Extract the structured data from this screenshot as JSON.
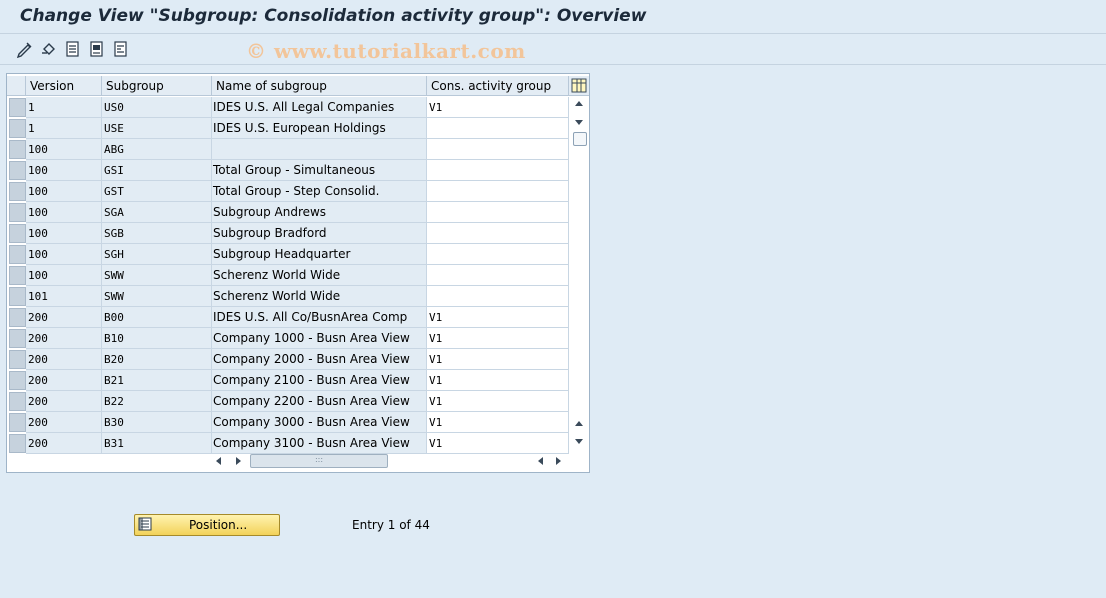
{
  "title": "Change View \"Subgroup: Consolidation activity group\": Overview",
  "watermark": "© www.tutorialkart.com",
  "toolbar": {
    "icons": [
      "change-display-icon",
      "undo-icon",
      "select-all-icon",
      "select-block-icon",
      "deselect-all-icon"
    ]
  },
  "table": {
    "columns": [
      "Version",
      "Subgroup",
      "Name of subgroup",
      "Cons. activity group"
    ],
    "rows": [
      {
        "version": "1",
        "subgroup": "US0",
        "name": "IDES U.S. All Legal Companies",
        "cons": "V1"
      },
      {
        "version": "1",
        "subgroup": "USE",
        "name": "IDES U.S. European Holdings",
        "cons": ""
      },
      {
        "version": "100",
        "subgroup": "ABG",
        "name": "",
        "cons": ""
      },
      {
        "version": "100",
        "subgroup": "GSI",
        "name": "Total Group - Simultaneous",
        "cons": ""
      },
      {
        "version": "100",
        "subgroup": "GST",
        "name": "Total Group - Step Consolid.",
        "cons": ""
      },
      {
        "version": "100",
        "subgroup": "SGA",
        "name": "Subgroup Andrews",
        "cons": ""
      },
      {
        "version": "100",
        "subgroup": "SGB",
        "name": "Subgroup Bradford",
        "cons": ""
      },
      {
        "version": "100",
        "subgroup": "SGH",
        "name": "Subgroup Headquarter",
        "cons": ""
      },
      {
        "version": "100",
        "subgroup": "SWW",
        "name": "Scherenz World Wide",
        "cons": ""
      },
      {
        "version": "101",
        "subgroup": "SWW",
        "name": "Scherenz World Wide",
        "cons": ""
      },
      {
        "version": "200",
        "subgroup": "B00",
        "name": "IDES U.S. All Co/BusnArea Comp",
        "cons": "V1"
      },
      {
        "version": "200",
        "subgroup": "B10",
        "name": "Company 1000 - Busn Area View",
        "cons": "V1"
      },
      {
        "version": "200",
        "subgroup": "B20",
        "name": "Company 2000 - Busn Area View",
        "cons": "V1"
      },
      {
        "version": "200",
        "subgroup": "B21",
        "name": "Company 2100 - Busn Area View",
        "cons": "V1"
      },
      {
        "version": "200",
        "subgroup": "B22",
        "name": "Company 2200 - Busn Area View",
        "cons": "V1"
      },
      {
        "version": "200",
        "subgroup": "B30",
        "name": "Company 3000 - Busn Area View",
        "cons": "V1"
      },
      {
        "version": "200",
        "subgroup": "B31",
        "name": "Company 3100 - Busn Area View",
        "cons": "V1"
      }
    ]
  },
  "position_button": "Position...",
  "entry_text": "Entry 1 of 44"
}
